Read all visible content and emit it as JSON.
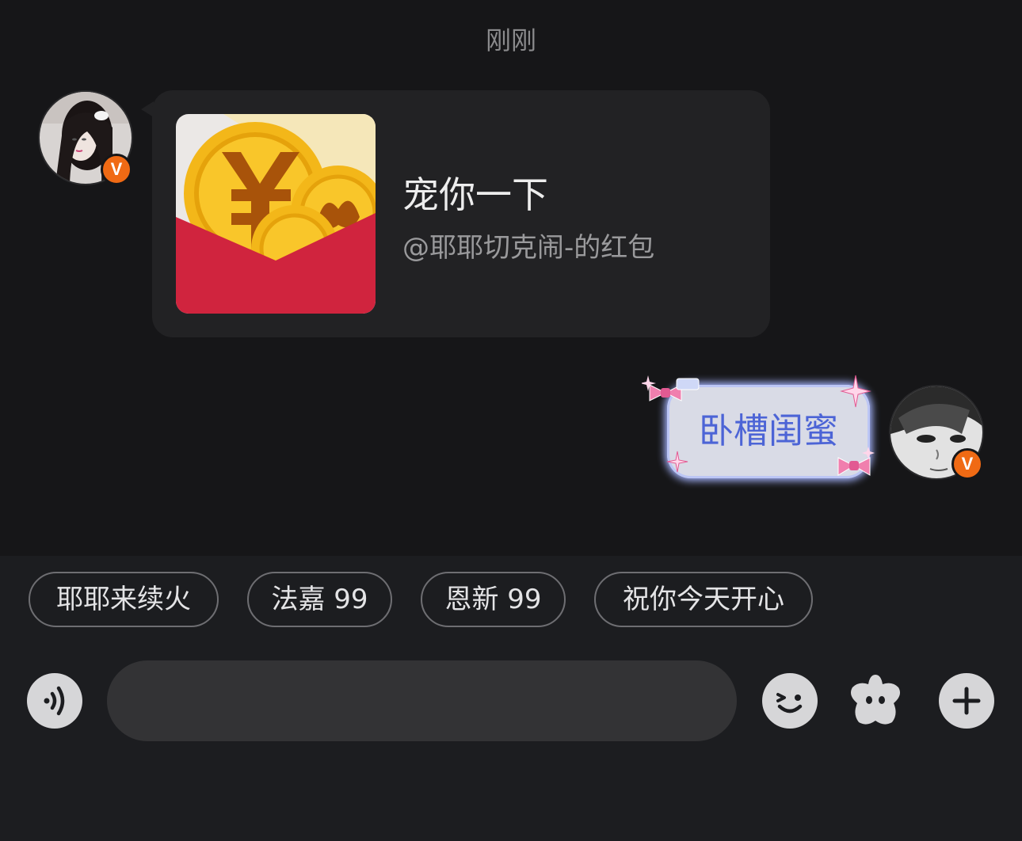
{
  "timestamp": "刚刚",
  "messages": {
    "incoming": {
      "title": "宠你一下",
      "subtitle": "@耶耶切克闹-的红包",
      "badge": "V"
    },
    "outgoing": {
      "text": "卧槽闺蜜",
      "badge": "V"
    }
  },
  "quick_replies": [
    "耶耶来续火",
    "法嘉 99",
    "恩新 99",
    "祝你今天开心"
  ],
  "input": {
    "placeholder": ""
  },
  "icons": {
    "voice": "voice-wave-icon",
    "emoji": "wink-emoji-icon",
    "sticker": "star-sticker-icon",
    "more": "plus-icon"
  },
  "colors": {
    "badge": "#f06a14",
    "packet_red": "#d0243e",
    "outgoing_text": "#4c64d6"
  }
}
